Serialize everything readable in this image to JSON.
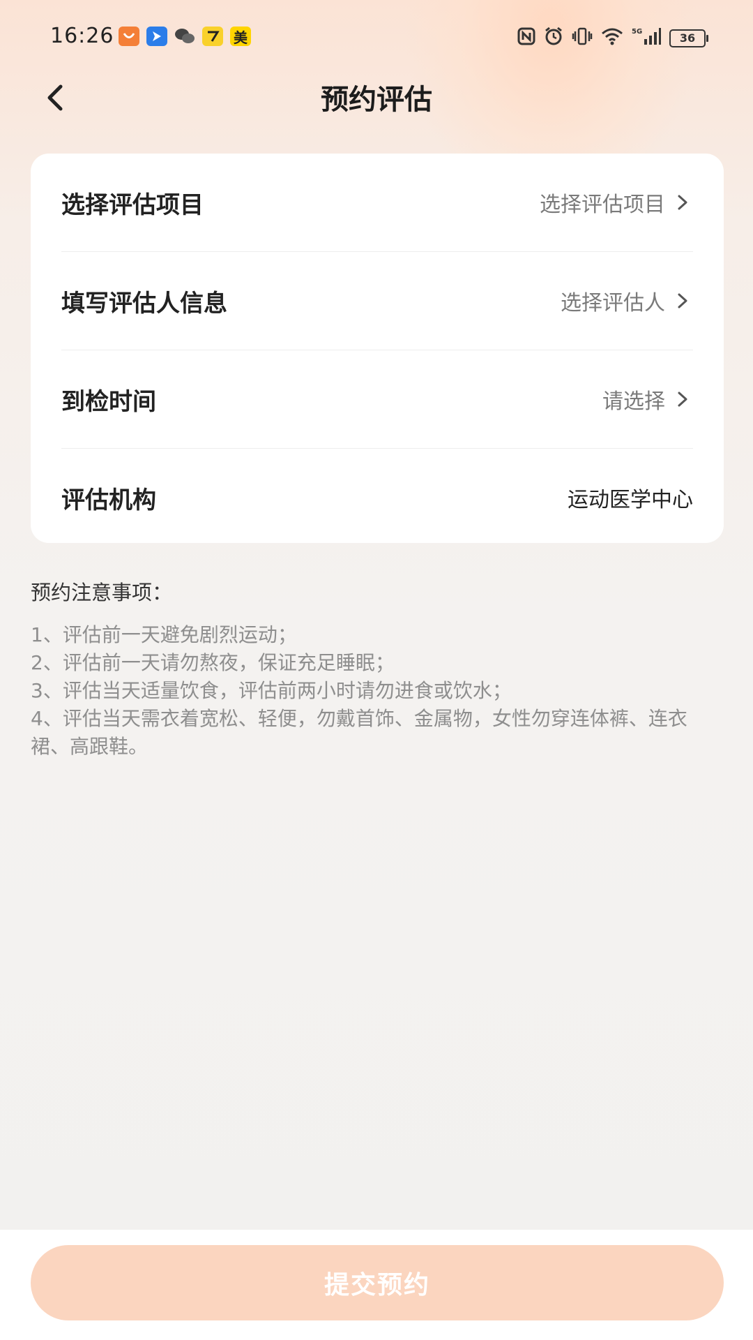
{
  "status_bar": {
    "time": "16:26",
    "notification_icons": [
      "taobao-icon",
      "navigation-icon",
      "wechat-icon",
      "qimao-icon",
      "meituan-icon"
    ],
    "meituan_label": "美",
    "system_icons": [
      "nfc-icon",
      "alarm-icon",
      "vibrate-icon",
      "wifi-icon",
      "signal-5g-icon",
      "battery-icon"
    ],
    "network": "5G",
    "battery": "36"
  },
  "header": {
    "title": "预约评估"
  },
  "form": {
    "rows": [
      {
        "label": "选择评估项目",
        "value": "选择评估项目",
        "has_arrow": true
      },
      {
        "label": "填写评估人信息",
        "value": "选择评估人",
        "has_arrow": true
      },
      {
        "label": "到检时间",
        "value": "请选择",
        "has_arrow": true
      },
      {
        "label": "评估机构",
        "value": "运动医学中心",
        "has_arrow": false
      }
    ]
  },
  "notes": {
    "title": "预约注意事项：",
    "items": [
      "1、评估前一天避免剧烈运动；",
      "2、评估前一天请勿熬夜，保证充足睡眠；",
      "3、评估当天适量饮食，评估前两小时请勿进食或饮水；",
      "4、评估当天需衣着宽松、轻便，勿戴首饰、金属物，女性勿穿连体裤、连衣裙、高跟鞋。"
    ]
  },
  "submit": {
    "label": "提交预约"
  },
  "colors": {
    "accent_disabled": "#fbd5bf",
    "background_top": "#fbe3d5",
    "text_primary": "#222222",
    "text_secondary": "#7a7a7a"
  }
}
